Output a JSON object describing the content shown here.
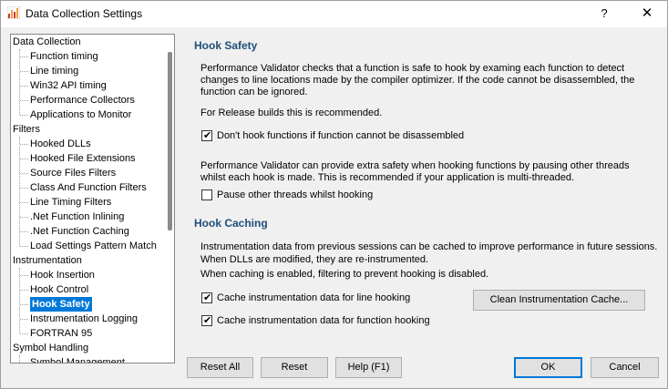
{
  "window": {
    "title": "Data Collection Settings",
    "help_glyph": "?",
    "close_glyph": "✕",
    "icon": "bar-chart-icon"
  },
  "tree": {
    "items": [
      {
        "label": "Data Collection",
        "level": 0
      },
      {
        "label": "Function timing",
        "level": 1
      },
      {
        "label": "Line timing",
        "level": 1
      },
      {
        "label": "Win32 API timing",
        "level": 1
      },
      {
        "label": "Performance Collectors",
        "level": 1
      },
      {
        "label": "Applications to Monitor",
        "level": 1
      },
      {
        "label": "Filters",
        "level": 0
      },
      {
        "label": "Hooked DLLs",
        "level": 1
      },
      {
        "label": "Hooked File Extensions",
        "level": 1
      },
      {
        "label": "Source Files Filters",
        "level": 1
      },
      {
        "label": "Class And Function Filters",
        "level": 1
      },
      {
        "label": "Line Timing Filters",
        "level": 1
      },
      {
        "label": ".Net Function Inlining",
        "level": 1
      },
      {
        "label": ".Net Function Caching",
        "level": 1
      },
      {
        "label": "Load Settings Pattern Match",
        "level": 1
      },
      {
        "label": "Instrumentation",
        "level": 0
      },
      {
        "label": "Hook Insertion",
        "level": 1
      },
      {
        "label": "Hook Control",
        "level": 1
      },
      {
        "label": "Hook Safety",
        "level": 1,
        "selected": true
      },
      {
        "label": "Instrumentation Logging",
        "level": 1
      },
      {
        "label": "FORTRAN 95",
        "level": 1
      },
      {
        "label": "Symbol Handling",
        "level": 0
      },
      {
        "label": "Symbol Management",
        "level": 1
      }
    ]
  },
  "hook_safety": {
    "title": "Hook Safety",
    "para1_line1": "Performance Validator checks that a function is safe to hook by examing each function to detect",
    "para1_line2": "changes to line locations made by the compiler optimizer. If the code cannot be disassembled, the",
    "para1_line3": "function can be ignored.",
    "release_note": "For Release builds this is recommended.",
    "chk_disassemble": {
      "label": "Don't hook functions if function cannot be disassembled",
      "checked": true
    },
    "para2_line1": "Performance Validator can provide extra safety when hooking functions by pausing other threads",
    "para2_line2": "whilst each hook is made. This is recommended if your application is multi-threaded.",
    "chk_pause": {
      "label": "Pause other threads whilst hooking",
      "checked": false
    }
  },
  "hook_caching": {
    "title": "Hook Caching",
    "line1": "Instrumentation data from previous sessions can be cached to improve performance in future sessions.",
    "line2": "When DLLs are modified, they are re-instrumented.",
    "line3": "When caching is enabled, filtering to prevent hooking is disabled.",
    "chk_line": {
      "label": "Cache instrumentation data for line hooking",
      "checked": true
    },
    "chk_function": {
      "label": "Cache instrumentation data for function hooking",
      "checked": true
    },
    "clean_button": "Clean Instrumentation Cache..."
  },
  "buttons": {
    "reset_all": "Reset All",
    "reset": "Reset",
    "help": "Help (F1)",
    "ok": "OK",
    "cancel": "Cancel"
  },
  "check_glyph": "✔"
}
